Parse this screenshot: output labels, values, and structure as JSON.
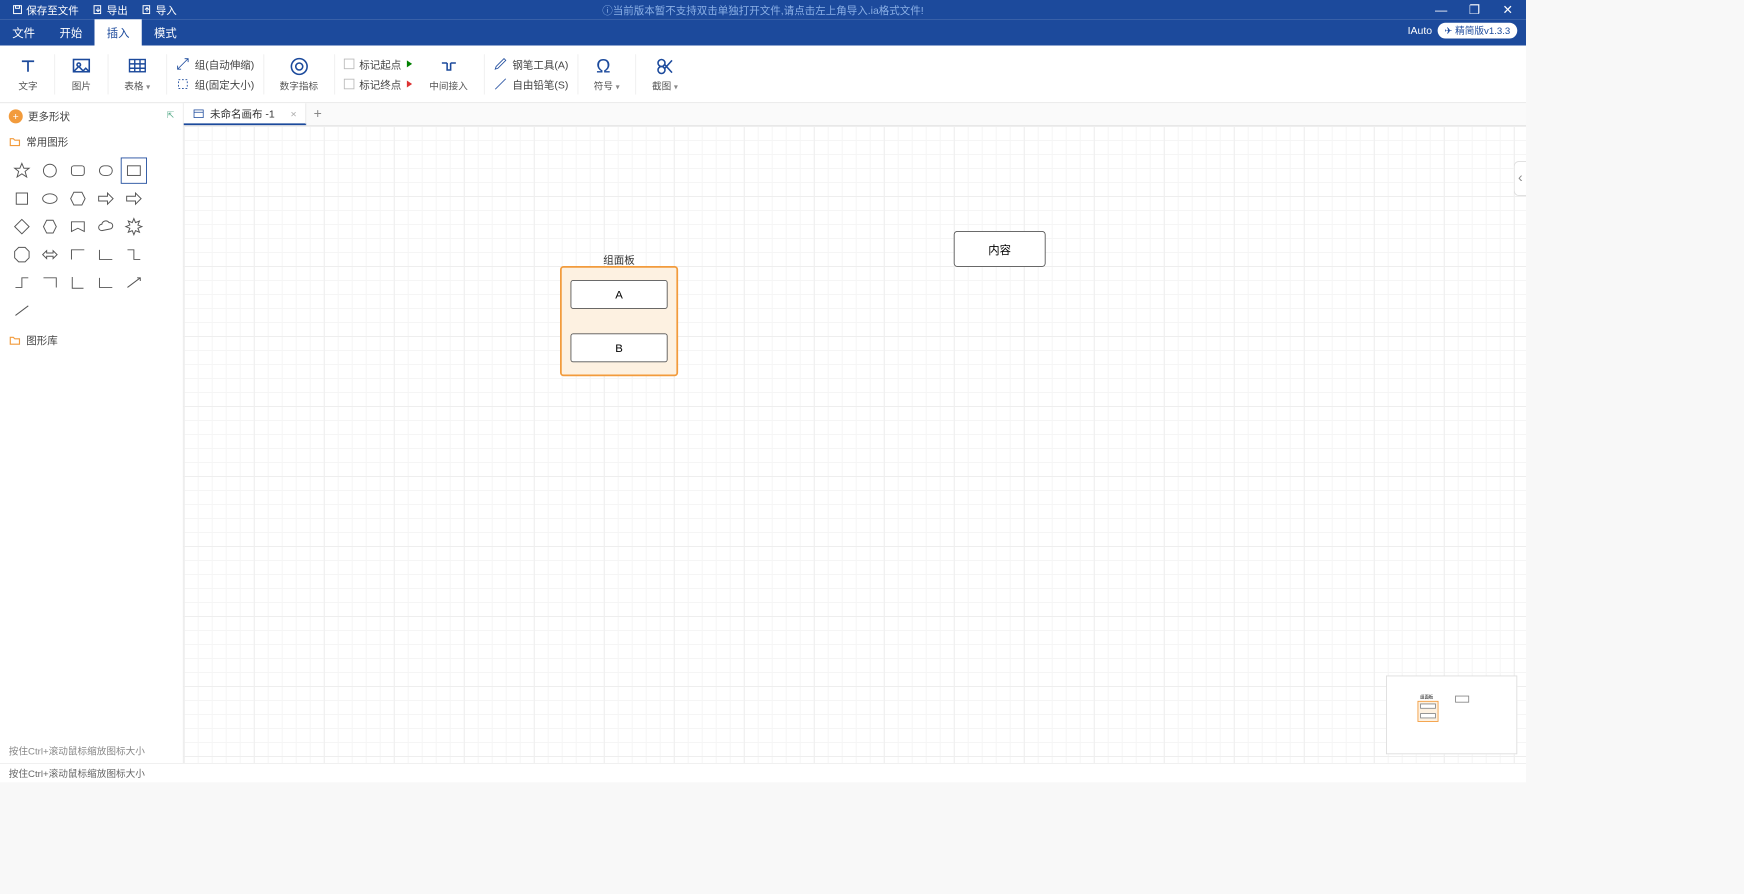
{
  "titlebar": {
    "save": "保存至文件",
    "export": "导出",
    "import": "导入",
    "notice": "ⓘ当前版本暂不支持双击单独打开文件,请点击左上角导入.ia格式文件!",
    "brand": "IAuto",
    "version": "精简版v1.3.3"
  },
  "menus": {
    "file": "文件",
    "start": "开始",
    "insert": "插入",
    "mode": "模式"
  },
  "ribbon": {
    "text": "文字",
    "image": "图片",
    "table": "表格",
    "group_auto": "组(自动伸缩)",
    "group_fixed": "组(固定大小)",
    "num_indicator": "数字指标",
    "mark_start": "标记起点",
    "mark_end": "标记终点",
    "mid_insert": "中间接入",
    "pen": "钢笔工具(A)",
    "free_pen": "自由铅笔(S)",
    "symbol": "符号",
    "screenshot": "截图"
  },
  "sidebar": {
    "more_shapes": "更多形状",
    "common": "常用图形",
    "library": "图形库",
    "hint": "按住Ctrl+滚动鼠标缩放图标大小",
    "shapes": [
      "star",
      "circle",
      "rrect",
      "rrect2",
      "rect",
      "square",
      "ellipse",
      "hex",
      "arrow-r",
      "arrow-hollow",
      "diamond",
      "hex2",
      "pent",
      "cloud",
      "burst",
      "oct",
      "darrow",
      "conn1",
      "conn2",
      "conn3",
      "conn4",
      "conn5",
      "elbow",
      "conn6",
      "conn7",
      "line"
    ]
  },
  "tabs": {
    "doc": "未命名画布 -1"
  },
  "canvas": {
    "panel_title": "组面板",
    "box_a": "A",
    "box_b": "B",
    "content_box": "内容"
  },
  "status": "按住Ctrl+滚动鼠标缩放图标大小"
}
